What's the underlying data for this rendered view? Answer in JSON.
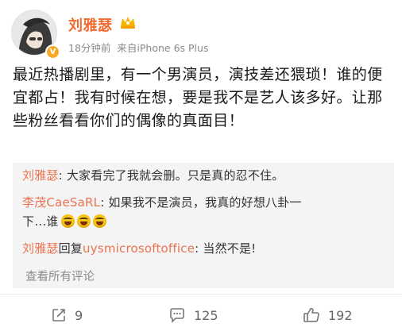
{
  "post": {
    "author": "刘雅瑟",
    "time_ago": "18分钟前",
    "source": "来自iPhone 6s Plus",
    "text": "最近热播剧里，有一个男演员，演技差还猥琐！谁的便宜都占！我有时候在想，要是我不是艺人该多好。让那些粉丝看看你们的偶像的真面目！"
  },
  "comments": [
    {
      "author": "刘雅瑟",
      "sep": ": ",
      "text": "大家看完了我就会删。只是真的忍不住。"
    },
    {
      "author": "李茂CaeSaRL",
      "sep": ": ",
      "text_line1": "如果我不是演员，我真的好想八卦一",
      "text_line2": "下…谁"
    },
    {
      "author": "刘雅瑟",
      "reply_word": "回复",
      "reply_to": "uysmicrosoftoffice",
      "sep": ": ",
      "text": "当然不是!"
    }
  ],
  "view_all": "查看所有评论",
  "actions": {
    "repost_count": "9",
    "comment_count": "125",
    "like_count": "192"
  },
  "colors": {
    "author_accent": "#f26a2f",
    "comment_author": "#eb7350",
    "meta_gray": "#8a8a8a",
    "comment_bg": "#f4f4f4"
  },
  "icons": [
    "vip-crown-icon",
    "verified-badge-icon",
    "repost-icon",
    "comment-icon",
    "like-icon",
    "laugh-emoji-icon"
  ]
}
